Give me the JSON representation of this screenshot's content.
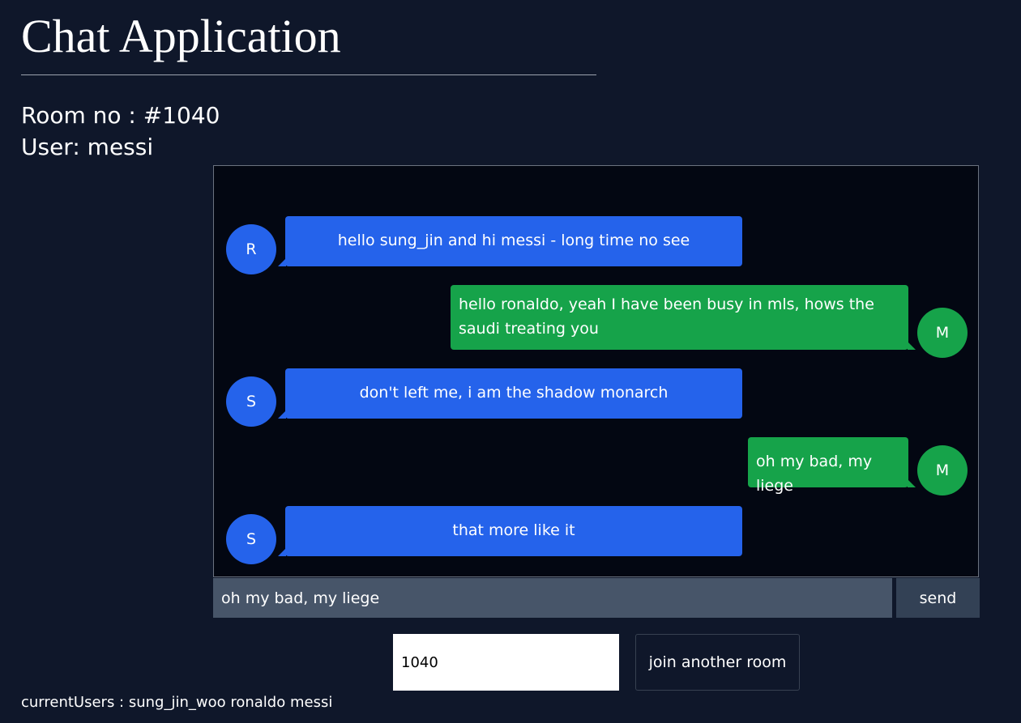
{
  "header": {
    "title": "Chat Application",
    "room_label": "Room no : #1040",
    "user_label": "User: messi"
  },
  "messages": [
    {
      "avatar": "R",
      "side": "left",
      "text": "hello sung_jin and hi messi - long time no see"
    },
    {
      "avatar": "M",
      "side": "right",
      "text": "hello ronaldo, yeah I have been busy in mls, hows the saudi treating you"
    },
    {
      "avatar": "S",
      "side": "left",
      "text": "don't left me, i am the shadow monarch"
    },
    {
      "avatar": "M",
      "side": "right",
      "text": "oh my bad, my liege"
    },
    {
      "avatar": "S",
      "side": "left",
      "text": "that more like it"
    }
  ],
  "composer": {
    "input_value": "oh my bad, my liege",
    "send_label": "send"
  },
  "room_switch": {
    "input_value": "1040",
    "join_label": "join another room"
  },
  "footer": {
    "current_users_label": "currentUsers : sung_jin_woo ronaldo messi"
  },
  "colors": {
    "background": "#0f172a",
    "chat_background": "#030712",
    "incoming": "#2563eb",
    "outgoing": "#16a34a",
    "input_background": "#475569",
    "send_background": "#334155"
  }
}
